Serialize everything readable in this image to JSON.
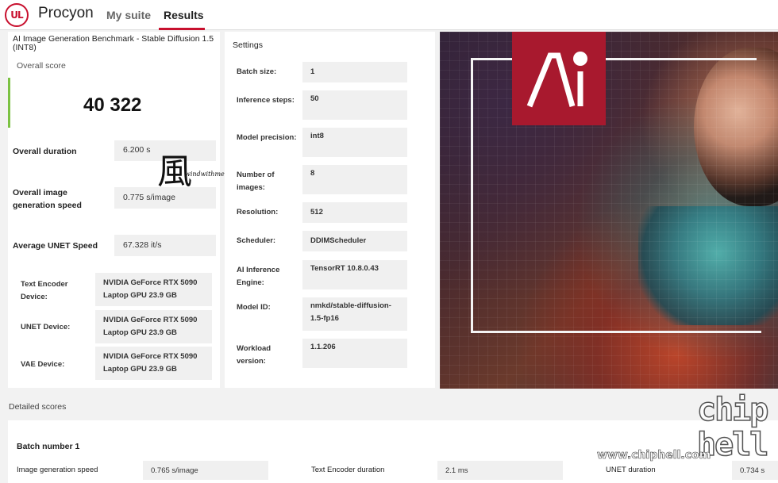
{
  "header": {
    "logo_text": "UL",
    "brand": "Procyon",
    "nav": [
      {
        "label": "My suite",
        "active": false
      },
      {
        "label": "Results",
        "active": true
      }
    ],
    "accent_color": "#c8102e"
  },
  "summary": {
    "title": "AI Image Generation Benchmark - Stable Diffusion 1.5 (INT8)",
    "overall_score_label": "Overall score",
    "overall_score": "40 322",
    "score_indicator_color": "#7cc243",
    "stats": [
      {
        "label": "Overall duration",
        "value": "6.200 s"
      },
      {
        "label": "Overall image generation speed",
        "value": "0.775 s/image"
      },
      {
        "label": "Average UNET Speed",
        "value": "67.328 it/s"
      }
    ],
    "devices": [
      {
        "label": "Text Encoder Device:",
        "value": "NVIDIA GeForce RTX 5090 Laptop GPU 23.9 GB"
      },
      {
        "label": "UNET Device:",
        "value": "NVIDIA GeForce RTX 5090 Laptop GPU 23.9 GB"
      },
      {
        "label": "VAE Device:",
        "value": "NVIDIA GeForce RTX 5090 Laptop GPU 23.9 GB"
      }
    ]
  },
  "settings": {
    "title": "Settings",
    "items": [
      {
        "label": "Batch size:",
        "value": "1"
      },
      {
        "label": "Inference steps:",
        "value": "50"
      },
      {
        "label": "Model precision:",
        "value": "int8"
      },
      {
        "label": "Number of images:",
        "value": "8"
      },
      {
        "label": "Resolution:",
        "value": "512"
      },
      {
        "label": "Scheduler:",
        "value": "DDIMScheduler"
      },
      {
        "label": "AI Inference Engine:",
        "value": "TensorRT 10.8.0.43"
      },
      {
        "label": "Model ID:",
        "value": "nmkd/stable-diffusion-1.5-fp16"
      },
      {
        "label": "Workload version:",
        "value": "1.1.206"
      }
    ]
  },
  "hero": {
    "badge_text": "AI",
    "badge_color": "#a8192e"
  },
  "watermark": {
    "glyph": "風",
    "text": "windwithme"
  },
  "detailed": {
    "heading": "Detailed scores",
    "batch_title": "Batch number 1",
    "rows": [
      {
        "label": "Image generation speed",
        "value": "0.765 s/image"
      },
      {
        "label": "Text Encoder duration",
        "value": "2.1 ms"
      },
      {
        "label": "UNET duration",
        "value": "0.734 s"
      }
    ]
  },
  "site_watermark": {
    "logo": "chip hell",
    "url": "www.chiphell.com"
  }
}
